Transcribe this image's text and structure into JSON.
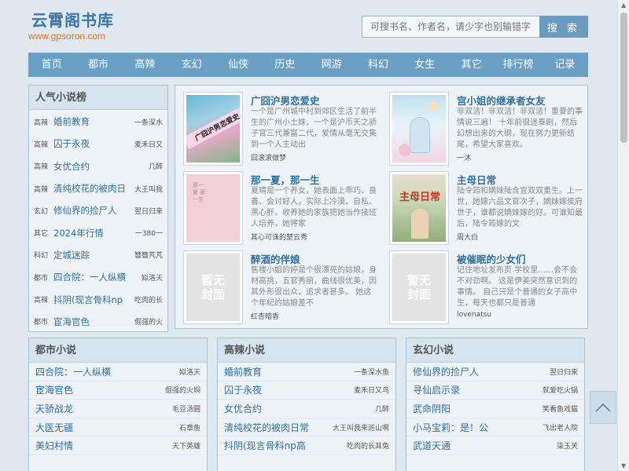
{
  "site": {
    "title": "云霄阁书库",
    "url": "www.gpsoron.com"
  },
  "search": {
    "placeholder": "可搜书名、作者名，请少字也别输错字",
    "button": "搜 索"
  },
  "nav": [
    "首页",
    "都市",
    "高辣",
    "玄幻",
    "仙侠",
    "历史",
    "网游",
    "科幻",
    "女生",
    "其它",
    "排行榜",
    "记录"
  ],
  "popular": {
    "heading": "人气小说榜",
    "items": [
      {
        "cat": "高辣",
        "title": "婚前教育",
        "author": "一条深水"
      },
      {
        "cat": "高辣",
        "title": "囚于永夜",
        "author": "麦禾日又"
      },
      {
        "cat": "高辣",
        "title": "女优合约",
        "author": "几醉"
      },
      {
        "cat": "高辣",
        "title": "清纯校花的被肉日",
        "author": "大王叫我"
      },
      {
        "cat": "玄幻",
        "title": "修仙界的捡尸人",
        "author": "翌日归来"
      },
      {
        "cat": "其它",
        "title": "2024年行情",
        "author": "一380一"
      },
      {
        "cat": "科幻",
        "title": "定城迷踪",
        "author": "簪簪芃芃"
      },
      {
        "cat": "都市",
        "title": "四合院：一人纵横",
        "author": "姒洛天"
      },
      {
        "cat": "高辣",
        "title": "抖阴(现言骨科np",
        "author": "吃肉的长"
      },
      {
        "cat": "都市",
        "title": "宦海官色",
        "author": "倔强的火"
      }
    ]
  },
  "featured": [
    {
      "title": "广囧沪男恋爱史",
      "desc": "一个是广州城中村到郊区生活了前半生的广州小土妹，一个是沪币天之骄子官三代兼富二代，爱情从毫无交集到一个人主动出",
      "author": "囧滚滚做梦",
      "cover": "cover-1",
      "cover_text": "广囧沪男恋爱史"
    },
    {
      "title": "宫小姐的继承者女友",
      "desc": "非双洁！非双洁！非双洁！重要的事情说三遍！ 十年前很迷泰剧，然后幻想出来的大纲，现在努力更新结尾，希望大家喜欢。",
      "author": "一沐",
      "cover": "cover-2",
      "cover_text": ""
    },
    {
      "title": "那一夏，那一生",
      "desc": "夏晴是一个养女，她表面上乖巧、良善、会讨好人，实际上冷漠、自私、黑心肝。收养她的家族把她当作接班人培养，她将家",
      "author": "其心可诛的楚云秀",
      "cover": "cover-3",
      "cover_text": "那一夏 那一生"
    },
    {
      "title": "主母日常",
      "desc": "陆令筠和嫡妹陆含宜双双重生。上一世，她嫁六品文官次子，嫡妹嫁侯府世子，谁都说嫡妹嫁的好。可谁知最后，陆令筠嫁的文",
      "author": "周大白",
      "cover": "cover-4",
      "cover_text": "主母日常"
    },
    {
      "title": "醉酒的伴娘",
      "desc": "售楼小姐的婷是个很漂亮的姑娘，身材高挑，五官秀丽，曲线很优美，因其外形很出众，追求者甚多。 她这个年纪的姑娘差不",
      "author": "红杏暗香",
      "cover": "none",
      "cover_text": "暂无\n封面"
    },
    {
      "title": "被催眠的少女们",
      "desc": "记住地址发布页 学校里……会不会不对劲啊。 这是伊美突然意识到的事情。 自己只是个普通的女子高中生，每天也都只是普通",
      "author": "lovenatsu",
      "cover": "none",
      "cover_text": "暂无\n封面"
    }
  ],
  "categories": [
    {
      "heading": "都市小说",
      "items": [
        {
          "title": "四合院：一人纵横",
          "author": "姒洛天"
        },
        {
          "title": "宦海官色",
          "author": "倔强的火焖"
        },
        {
          "title": "天骄战龙",
          "author": "毛豆汤圆"
        },
        {
          "title": "大医无疆",
          "author": "石章鱼"
        },
        {
          "title": "美妇村情",
          "author": "天下英雄"
        }
      ]
    },
    {
      "heading": "高辣小说",
      "items": [
        {
          "title": "婚前教育",
          "author": "一条深水鱼"
        },
        {
          "title": "囚于永夜",
          "author": "麦禾日又鸟"
        },
        {
          "title": "女优合约",
          "author": "几醉"
        },
        {
          "title": "清纯校花的被肉日常",
          "author": "大王叫我来巡山啊"
        },
        {
          "title": "抖阴(现言骨科np高",
          "author": "吃肉的长耳兔"
        }
      ]
    },
    {
      "heading": "玄幻小说",
      "items": [
        {
          "title": "修仙界的捡尸人",
          "author": "翌日归来"
        },
        {
          "title": "寻仙启示录",
          "author": "就爱吃火锅"
        },
        {
          "title": "武命阴阳",
          "author": "笑看鱼戏猫"
        },
        {
          "title": "小马宝莉：是！公",
          "author": "飞出老人院"
        },
        {
          "title": "武道天通",
          "author": "柒玉关"
        }
      ]
    }
  ],
  "colors": {
    "accent": "#6aa0c6",
    "link": "#2f6fa0",
    "brand_url": "#e8731a"
  },
  "icons": {
    "back_to_top": "chevron-up-icon"
  }
}
